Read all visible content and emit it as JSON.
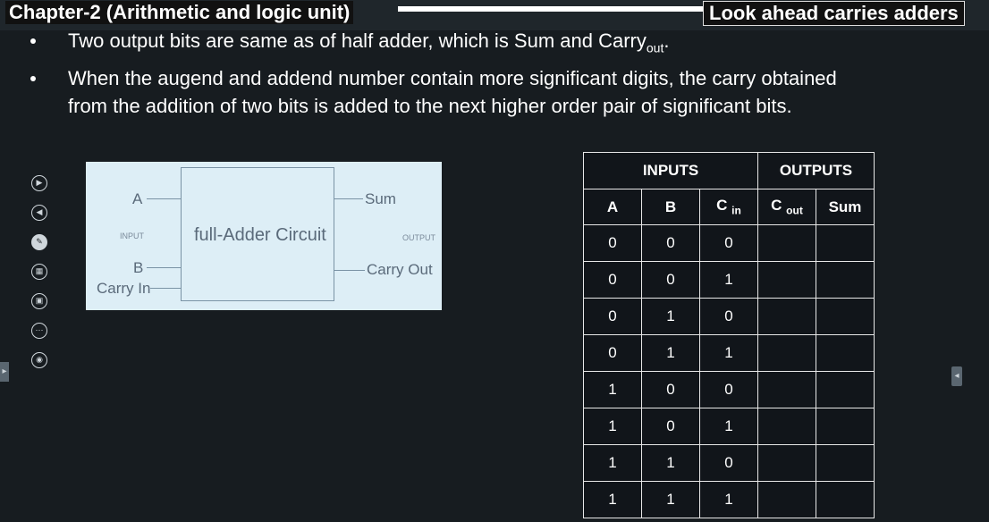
{
  "header": {
    "chapter_title": "Chapter-2 (Arithmetic and logic unit)",
    "slide_title": "Look ahead carries adders"
  },
  "bullets": [
    {
      "text": "Two output bits are same as of half adder, which is Sum and Carry",
      "sub": "out",
      "suffix": "."
    },
    {
      "line1": "When the augend and addend number contain more significant digits, the carry obtained",
      "line2": "from the addition of two bits is added to the next higher order pair of significant bits."
    }
  ],
  "circuit": {
    "input_a": "A",
    "input_b": "B",
    "carry_in": "Carry In",
    "input_caption": "INPUT",
    "box_label": "full-Adder Circuit",
    "output_caption": "OUTPUT",
    "sum": "Sum",
    "carry_out": "Carry Out"
  },
  "table": {
    "group_inputs": "INPUTS",
    "group_outputs": "OUTPUTS",
    "col_a": "A",
    "col_b": "B",
    "col_cin": "C",
    "col_cin_sub": "in",
    "col_cout": "C",
    "col_cout_sub": "out",
    "col_sum": "Sum",
    "rows": [
      [
        "0",
        "0",
        "0",
        "",
        ""
      ],
      [
        "0",
        "0",
        "1",
        "",
        ""
      ],
      [
        "0",
        "1",
        "0",
        "",
        ""
      ],
      [
        "0",
        "1",
        "1",
        "",
        ""
      ],
      [
        "1",
        "0",
        "0",
        "",
        ""
      ],
      [
        "1",
        "0",
        "1",
        "",
        ""
      ],
      [
        "1",
        "1",
        "0",
        "",
        ""
      ],
      [
        "1",
        "1",
        "1",
        "",
        ""
      ]
    ]
  },
  "toolbar": {
    "icons": [
      "play-forward-icon",
      "play-back-icon",
      "pen-icon",
      "shape-icon",
      "screen-icon",
      "more-icon",
      "camera-icon"
    ]
  }
}
